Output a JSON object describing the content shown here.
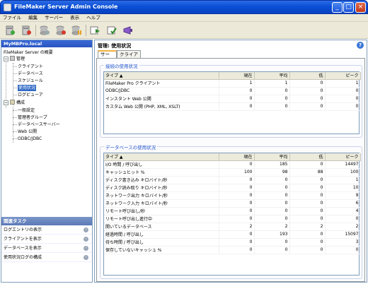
{
  "window": {
    "title": "FileMaker Server Admin Console"
  },
  "menu": [
    "ファイル",
    "編集",
    "サーバー",
    "表示",
    "ヘルプ"
  ],
  "toolbar": {
    "icons": [
      "start-server-icon",
      "stop-server-icon",
      "open-database-icon",
      "close-database-icon",
      "pause-database-icon",
      "resume-database-icon",
      "verify-database-icon",
      "send-message-icon"
    ]
  },
  "sidebar": {
    "header": "MyMBPro.local",
    "root": "FileMaker Server の概要",
    "admin": "管理",
    "admin_items": [
      "クライアント",
      "データベース",
      "スケジュール",
      "使用状況",
      "ログビューア"
    ],
    "config": "構成",
    "config_items": [
      "一般設定",
      "管理者グループ",
      "データベースサーバー",
      "Web 公開",
      "ODBC/JDBC"
    ],
    "tasks_header": "関連タスク",
    "tasks": [
      "ログエントリの表示",
      "クライアントを表示",
      "データベースを表示",
      "使用状況ログの構成"
    ]
  },
  "main": {
    "title": "管理: 使用状況",
    "tabs": [
      "サーバー",
      "クライアント"
    ],
    "connections": {
      "title": "接続の使用状況",
      "columns": [
        "タイプ ▲",
        "現在",
        "平均",
        "低",
        "ピーク"
      ],
      "rows": [
        [
          "FileMaker Pro クライアント",
          "1",
          "1",
          "0",
          "1"
        ],
        [
          "ODBC/JDBC",
          "0",
          "0",
          "0",
          "0"
        ],
        [
          "インスタント Web 公開",
          "0",
          "0",
          "0",
          "0"
        ],
        [
          "カスタム Web 公開 (PHP, XML, XSLT)",
          "0",
          "0",
          "0",
          "0"
        ]
      ]
    },
    "databases": {
      "title": "データベースの使用状況",
      "columns": [
        "タイプ ▲",
        "現在",
        "平均",
        "低",
        "ピーク"
      ],
      "rows": [
        [
          "I/O 時間 / 呼び出し",
          "0",
          "185",
          "0",
          "14497"
        ],
        [
          "キャッシュヒット %",
          "100",
          "98",
          "88",
          "100"
        ],
        [
          "ディスク書き込み キロバイト/秒",
          "0",
          "0",
          "0",
          "1"
        ],
        [
          "ディスク読み取り キロバイト/秒",
          "0",
          "0",
          "0",
          "10"
        ],
        [
          "ネットワーク出力 キロバイト/秒",
          "0",
          "0",
          "0",
          "9"
        ],
        [
          "ネットワーク入力 キロバイト/秒",
          "0",
          "0",
          "0",
          "6"
        ],
        [
          "リモート呼び出し/秒",
          "0",
          "0",
          "0",
          "4"
        ],
        [
          "リモート呼び出し進行中",
          "0",
          "0",
          "0",
          "0"
        ],
        [
          "開いているデータベース",
          "2",
          "2",
          "2",
          "2"
        ],
        [
          "経過時間 / 呼び出し",
          "0",
          "193",
          "0",
          "15097"
        ],
        [
          "待ち時間 / 呼び出し",
          "0",
          "0",
          "0",
          "3"
        ],
        [
          "保存していないキャッシュ %",
          "0",
          "0",
          "0",
          "0"
        ]
      ]
    }
  }
}
